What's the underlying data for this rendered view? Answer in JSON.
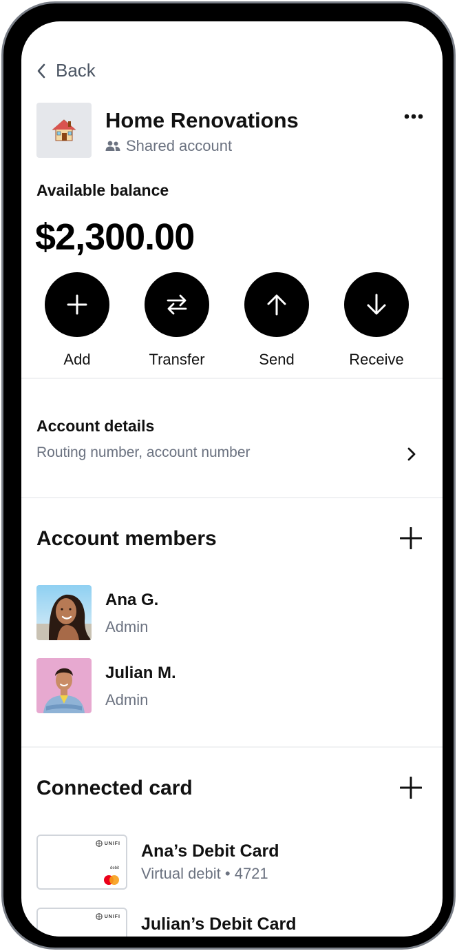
{
  "nav": {
    "back_label": "Back"
  },
  "account": {
    "title": "Home Renovations",
    "subtitle": "Shared account",
    "icon": "house-emoji"
  },
  "balance": {
    "label": "Available balance",
    "amount": "$2,300.00"
  },
  "actions": [
    {
      "label": "Add",
      "icon": "plus-icon"
    },
    {
      "label": "Transfer",
      "icon": "transfer-arrows-icon"
    },
    {
      "label": "Send",
      "icon": "arrow-up-icon"
    },
    {
      "label": "Receive",
      "icon": "arrow-down-icon"
    }
  ],
  "details": {
    "title": "Account details",
    "subtitle": "Routing number, account number"
  },
  "members": {
    "title": "Account members",
    "items": [
      {
        "name": "Ana G.",
        "role": "Admin"
      },
      {
        "name": "Julian M.",
        "role": "Admin"
      }
    ]
  },
  "cards": {
    "title": "Connected card",
    "brand": "UNIFI",
    "card_type_label": "debit",
    "items": [
      {
        "name": "Ana’s Debit Card",
        "subtitle": "Virtual debit • 4721"
      },
      {
        "name": "Julian’s Debit Card",
        "subtitle": ""
      }
    ]
  },
  "colors": {
    "primary": "#000000",
    "text_secondary": "#6b7280",
    "icon_bg": "#e5e7eb",
    "bezel": "#7a7f88"
  }
}
